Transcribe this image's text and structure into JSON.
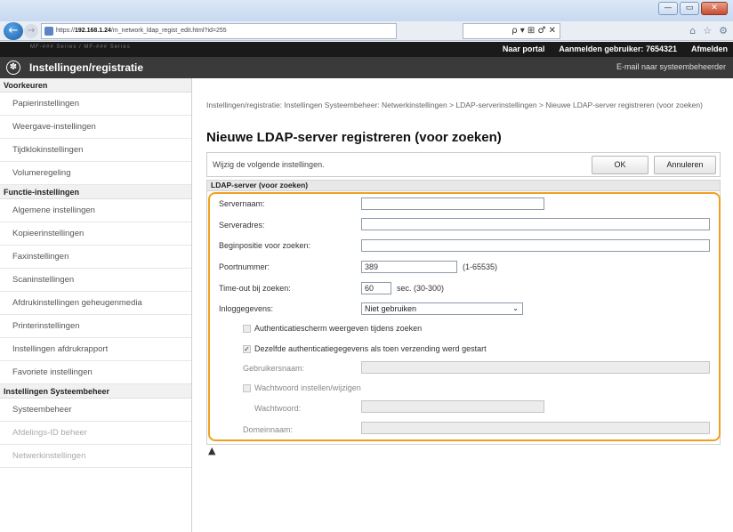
{
  "browser": {
    "url_prefix": "https://",
    "url_host": "192.168.1.24",
    "url_path": "/m_network_ldap_regist_edit.html?id=255",
    "tools_text": "ρ ▾ ⊞ ♂ ✕",
    "win_minimize": "—",
    "win_maximize": "▭",
    "win_close": "✕"
  },
  "topbar": {
    "model": "MF-### Series / MF-### Series",
    "portal_link": "Naar portal",
    "login_label": "Aanmelden gebruiker:",
    "login_user": "7654321",
    "logout_link": "Afmelden"
  },
  "app": {
    "title": "Instellingen/registratie",
    "admin_mail": "E-mail naar systeembeheerder"
  },
  "sidebar": {
    "sections": [
      {
        "title": "Voorkeuren",
        "items": [
          "Papierinstellingen",
          "Weergave-instellingen",
          "Tijdklokinstellingen",
          "Volumeregeling"
        ]
      },
      {
        "title": "Functie-instellingen",
        "items": [
          "Algemene instellingen",
          "Kopieerinstellingen",
          "Faxinstellingen",
          "Scaninstellingen",
          "Afdrukinstellingen geheugenmedia",
          "Printerinstellingen",
          "Instellingen afdrukrapport",
          "Favoriete instellingen"
        ]
      },
      {
        "title": "Instellingen Systeembeheer",
        "items": [
          "Systeembeheer",
          "Afdelings-ID beheer",
          "Netwerkinstellingen"
        ]
      }
    ]
  },
  "main": {
    "breadcrumb": "Instellingen/registratie: Instellingen Systeembeheer: Netwerkinstellingen > LDAP-serverinstellingen > Nieuwe LDAP-server registreren (voor zoeken)",
    "page_title": "Nieuwe LDAP-server registreren (voor zoeken)",
    "hint": "Wijzig de volgende instellingen.",
    "ok_label": "OK",
    "cancel_label": "Annuleren",
    "section_title": "LDAP-server (voor zoeken)",
    "top_link": "▲"
  },
  "form": {
    "server_name_label": "Servernaam:",
    "server_name_value": "",
    "server_address_label": "Serveradres:",
    "server_address_value": "",
    "search_start_label": "Beginpositie voor zoeken:",
    "search_start_value": "",
    "port_label": "Poortnummer:",
    "port_value": "389",
    "port_range": "(1-65535)",
    "timeout_label": "Time-out bij zoeken:",
    "timeout_value": "60",
    "timeout_unit": "sec. (30-300)",
    "login_info_label": "Inloggegevens:",
    "login_info_value": "Niet gebruiken",
    "auth_screen_label": "Authenticatiescherm weergeven tijdens zoeken",
    "auth_screen_checked": false,
    "same_auth_label": "Dezelfde authenticatiegegevens als toen verzending werd gestart",
    "same_auth_checked": true,
    "username_label": "Gebruikersnaam:",
    "set_password_label": "Wachtwoord instellen/wijzigen",
    "set_password_checked": false,
    "password_label": "Wachtwoord:",
    "domain_label": "Domeinnaam:",
    "check_mark": "✓"
  }
}
